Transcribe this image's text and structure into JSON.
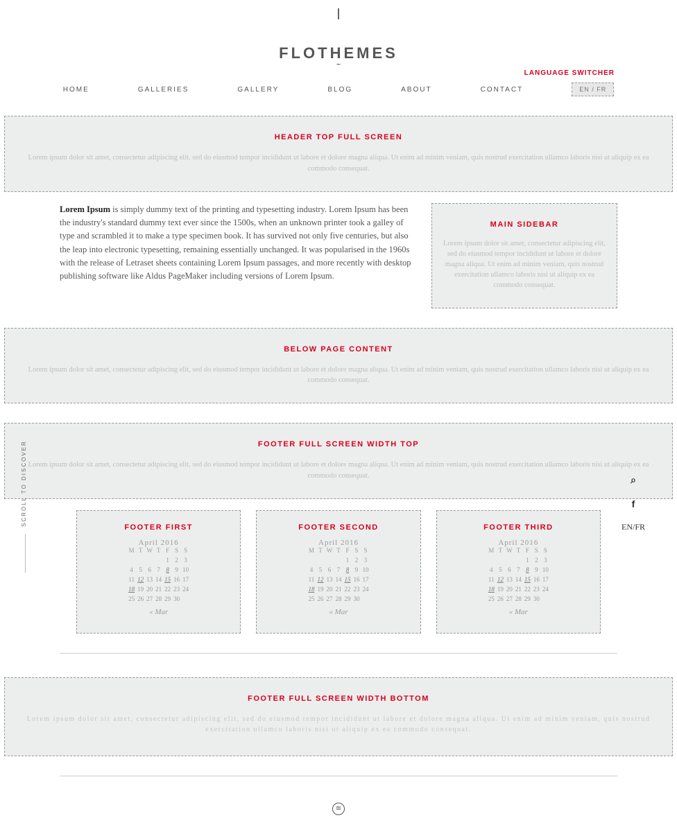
{
  "brand": {
    "name": "FLOTHEMES"
  },
  "langSwitcher": {
    "label": "LANGUAGE SWITCHER",
    "box": "EN / FR"
  },
  "nav": {
    "items": [
      "HOME",
      "GALLERIES",
      "GALLERY",
      "BLOG",
      "ABOUT",
      "CONTACT"
    ]
  },
  "regions": {
    "headerTop": {
      "title": "HEADER TOP FULL SCREEN",
      "lorem": "Lorem ipsum dolor sit amet, consectetur adipiscing elit, sed do eiusmod tempor incididunt ut labore et dolore magna aliqua. Ut enim ad minim veniam, quis nostrud exercitation ullamco laboris nisi ut aliquip ex ea commodo consequat."
    },
    "belowContent": {
      "title": "BELOW PAGE CONTENT",
      "lorem": "Lorem ipsum dolor sit amet, consectetur adipiscing elit, sed do eiusmod tempor incididunt ut labore et dolore magna aliqua. Ut enim ad minim veniam, quis nostrud exercitation ullamco laboris nisi ut aliquip ex ea commodo consequat."
    },
    "footerTop": {
      "title": "FOOTER FULL SCREEN WIDTH TOP",
      "lorem": "Lorem ipsum dolor sit amet, consectetur adipiscing elit, sed do eiusmod tempor incididunt ut labore et dolore magna aliqua. Ut enim ad minim veniam, quis nostrud exercitation ullamco laboris nisi ut aliquip ex ea commodo consequat."
    },
    "footerBottom": {
      "title": "FOOTER FULL SCREEN WIDTH BOTTOM",
      "lorem": "Lorem ipsum dolor sit amet, consectetur adipiscing elit, sed do eiusmod tempor incididunt ut labore et dolore magna aliqua. Ut enim ad minim veniam, quis nostrud exercitation ullamco laboris nisi ut aliquip ex ea commodo consequat."
    }
  },
  "article": {
    "strong": "Lorem Ipsum",
    "body": " is simply dummy text of the printing and typesetting industry. Lorem Ipsum has been the industry's standard dummy text ever since the 1500s, when an unknown printer took a galley of type and scrambled it to make a type specimen book. It has survived not only five centuries, but also the leap into electronic typesetting, remaining essentially unchanged. It was popularised in the 1960s with the release of Letraset sheets containing Lorem Ipsum passages, and more recently with desktop publishing software like Aldus PageMaker including versions of Lorem Ipsum."
  },
  "sidebar": {
    "title": "MAIN SIDEBAR",
    "lorem": "Lorem ipsum dolor sit amet, consectetur adipiscing elit, sed do eiusmod tempor incididunt ut labore et dolore magna aliqua. Ut enim ad minim veniam, quis nostrud exercitation ullamco laboris nisi ut aliquip ex ea commodo consequat."
  },
  "footerCols": {
    "titles": [
      "FOOTER FIRST",
      "FOOTER SECOND",
      "FOOTER THIRD"
    ],
    "calendar": {
      "monthLabel": "April 2016",
      "dow": [
        "M",
        "T",
        "W",
        "T",
        "F",
        "S",
        "S"
      ],
      "rows": [
        [
          "",
          "",
          "",
          "",
          "1",
          "2",
          "3"
        ],
        [
          "4",
          "5",
          "6",
          "7",
          "8",
          "9",
          "10"
        ],
        [
          "11",
          "12",
          "13",
          "14",
          "15",
          "16",
          "17"
        ],
        [
          "18",
          "19",
          "20",
          "21",
          "22",
          "23",
          "24"
        ],
        [
          "25",
          "26",
          "27",
          "28",
          "29",
          "30",
          ""
        ]
      ],
      "highlights": [
        "8",
        "12",
        "15",
        "18"
      ],
      "prev": "« Mar"
    }
  },
  "scrollLabel": "SCROLL TO DISCOVER",
  "sideTools": {
    "search": "⌕",
    "social": "f",
    "lang": "EN/FR"
  },
  "bottomIcon": "≋"
}
